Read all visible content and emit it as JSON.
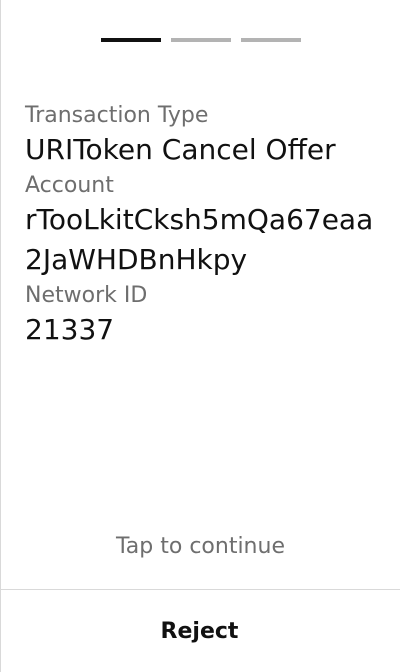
{
  "progress": {
    "steps": 3,
    "current": 1
  },
  "fields": [
    {
      "label": "Transaction Type",
      "value": "URIToken Cancel Offer"
    },
    {
      "label": "Account",
      "value": "rTooLkitCksh5mQa67eaa2JaWHDBnHkpy"
    },
    {
      "label": "Network ID",
      "value": "21337"
    }
  ],
  "tap_hint": "Tap to continue",
  "reject_label": "Reject",
  "colors": {
    "active_step": "#111111",
    "inactive_step": "#b3b3b3",
    "label_text": "#6e6e6e"
  }
}
